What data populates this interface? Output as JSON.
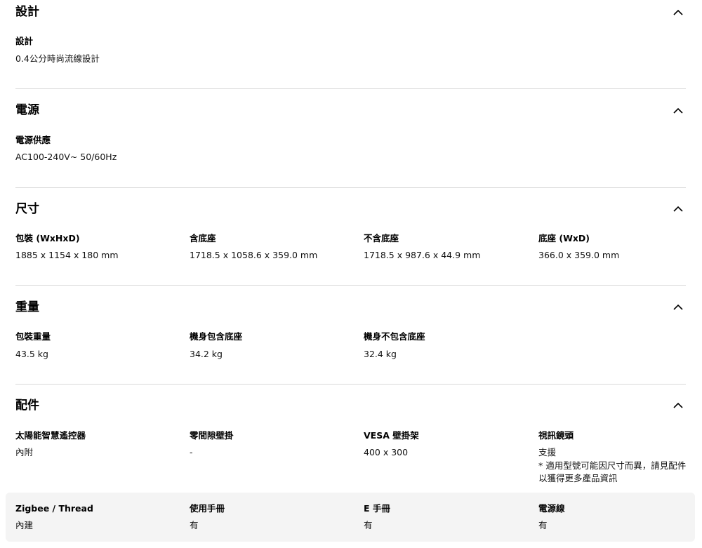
{
  "sections": {
    "design": {
      "title": "設計",
      "specs": [
        {
          "label": "設計",
          "value": "0.4公分時尚流線設計"
        }
      ]
    },
    "power": {
      "title": "電源",
      "specs": [
        {
          "label": "電源供應",
          "value": "AC100-240V~ 50/60Hz"
        }
      ]
    },
    "dimensions": {
      "title": "尺寸",
      "specs": [
        {
          "label": "包裝 (WxHxD)",
          "value": "1885 x 1154 x 180 mm"
        },
        {
          "label": "含底座",
          "value": "1718.5 x 1058.6 x 359.0 mm"
        },
        {
          "label": "不含底座",
          "value": "1718.5 x 987.6 x 44.9 mm"
        },
        {
          "label": "底座 (WxD)",
          "value": "366.0 x 359.0 mm"
        }
      ]
    },
    "weight": {
      "title": "重量",
      "specs": [
        {
          "label": "包裝重量",
          "value": "43.5 kg"
        },
        {
          "label": "機身包含底座",
          "value": "34.2 kg"
        },
        {
          "label": "機身不包含底座",
          "value": "32.4 kg"
        }
      ]
    },
    "accessories": {
      "title": "配件",
      "specs": [
        {
          "label": "太陽能智慧遙控器",
          "value": "內附"
        },
        {
          "label": "零間隙壁掛",
          "value": "-"
        },
        {
          "label": "VESA 壁掛架",
          "value": "400 x 300"
        },
        {
          "label": "視訊鏡頭",
          "value": "支援",
          "note": "* 適用型號可能因尺寸而異，請見配件以獲得更多產品資訊"
        }
      ],
      "specs_row2": [
        {
          "label": "Zigbee / Thread",
          "value": "內建"
        },
        {
          "label": "使用手冊",
          "value": "有"
        },
        {
          "label": "E 手冊",
          "value": "有"
        },
        {
          "label": "電源線",
          "value": "有"
        }
      ]
    }
  },
  "icons": {
    "collapse": "chevron-up-icon"
  }
}
